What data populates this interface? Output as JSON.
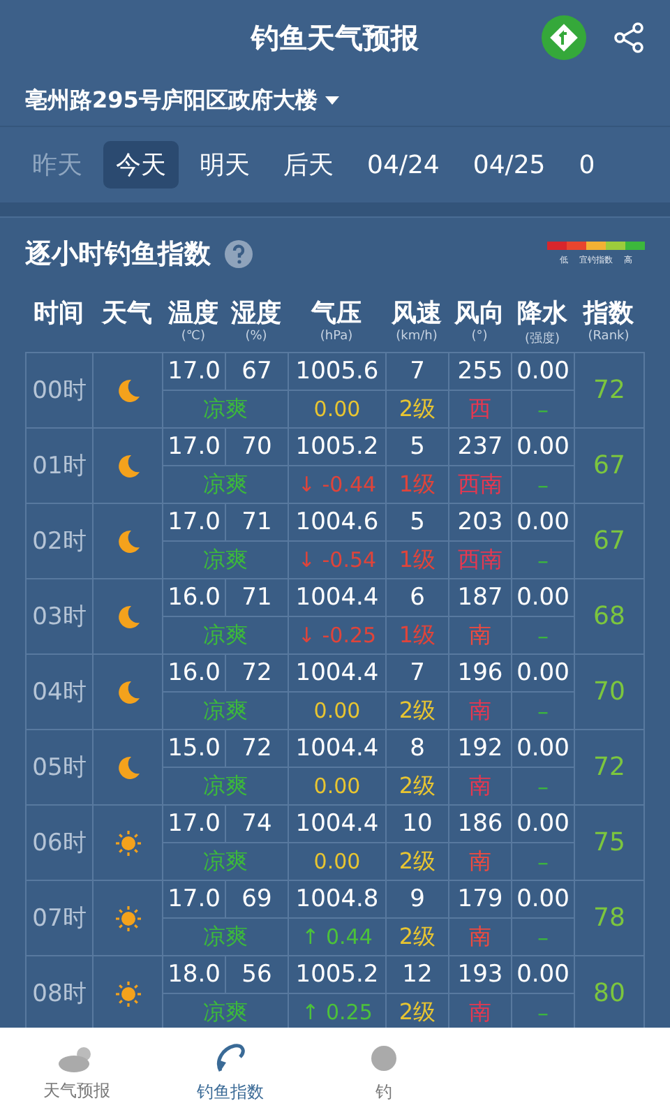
{
  "header": {
    "title": "钓鱼天气预报"
  },
  "location": {
    "text": "亳州路295号庐阳区政府大楼"
  },
  "date_tabs": [
    {
      "label": "昨天",
      "selected": false,
      "disabled": true
    },
    {
      "label": "今天",
      "selected": true,
      "disabled": false
    },
    {
      "label": "明天",
      "selected": false,
      "disabled": false
    },
    {
      "label": "后天",
      "selected": false,
      "disabled": false
    },
    {
      "label": "04/24",
      "selected": false,
      "disabled": false
    },
    {
      "label": "04/25",
      "selected": false,
      "disabled": false
    },
    {
      "label": "0",
      "selected": false,
      "disabled": false
    }
  ],
  "section": {
    "title": "逐小时钓鱼指数",
    "legend": {
      "low": "低",
      "label": "宜钓指数",
      "high": "高",
      "segments": [
        {
          "color": "#d8262c"
        },
        {
          "color": "#e8452e"
        },
        {
          "color": "#f2b134"
        },
        {
          "color": "#9ccc3c"
        },
        {
          "color": "#3cb83c"
        }
      ]
    }
  },
  "table": {
    "columns": [
      {
        "label": "时间"
      },
      {
        "label": "天气"
      },
      {
        "label": "温度",
        "unit": "(℃)"
      },
      {
        "label": "湿度",
        "unit": "(%)"
      },
      {
        "label": "气压",
        "unit": "(hPa)"
      },
      {
        "label": "风速",
        "unit": "(km/h)"
      },
      {
        "label": "风向",
        "unit": "(°)"
      },
      {
        "label": "降水",
        "unit": "(强度)"
      },
      {
        "label": "指数",
        "unit": "(Rank)"
      }
    ],
    "rows": [
      {
        "time": "00时",
        "weather": {
          "kind": "moon"
        },
        "temp": "17.0",
        "humidity": "67",
        "pressure": "1005.6",
        "wind": "7",
        "direction": "255",
        "precip": "0.00",
        "comfort": "凉爽",
        "pressure_change": {
          "text": "0.00",
          "color": "#e8c531"
        },
        "wind_level": {
          "text": "2级",
          "color": "#e8c531"
        },
        "direction_name": {
          "text": "西",
          "color": "#e8374f"
        },
        "precip_level": "–",
        "index": "72"
      },
      {
        "time": "01时",
        "weather": {
          "kind": "moon"
        },
        "temp": "17.0",
        "humidity": "70",
        "pressure": "1005.2",
        "wind": "5",
        "direction": "237",
        "precip": "0.00",
        "comfort": "凉爽",
        "pressure_change": {
          "text": "↓ -0.44",
          "color": "#e0443a"
        },
        "wind_level": {
          "text": "1级",
          "color": "#e0443a"
        },
        "direction_name": {
          "text": "西南",
          "color": "#e8374f"
        },
        "precip_level": "–",
        "index": "67"
      },
      {
        "time": "02时",
        "weather": {
          "kind": "moon"
        },
        "temp": "17.0",
        "humidity": "71",
        "pressure": "1004.6",
        "wind": "5",
        "direction": "203",
        "precip": "0.00",
        "comfort": "凉爽",
        "pressure_change": {
          "text": "↓ -0.54",
          "color": "#e0443a"
        },
        "wind_level": {
          "text": "1级",
          "color": "#e0443a"
        },
        "direction_name": {
          "text": "西南",
          "color": "#e8374f"
        },
        "precip_level": "–",
        "index": "67"
      },
      {
        "time": "03时",
        "weather": {
          "kind": "moon"
        },
        "temp": "16.0",
        "humidity": "71",
        "pressure": "1004.4",
        "wind": "6",
        "direction": "187",
        "precip": "0.00",
        "comfort": "凉爽",
        "pressure_change": {
          "text": "↓ -0.25",
          "color": "#e0443a"
        },
        "wind_level": {
          "text": "1级",
          "color": "#e0443a"
        },
        "direction_name": {
          "text": "南",
          "color": "#f04a3e"
        },
        "precip_level": "–",
        "index": "68"
      },
      {
        "time": "04时",
        "weather": {
          "kind": "moon"
        },
        "temp": "16.0",
        "humidity": "72",
        "pressure": "1004.4",
        "wind": "7",
        "direction": "196",
        "precip": "0.00",
        "comfort": "凉爽",
        "pressure_change": {
          "text": "0.00",
          "color": "#e8c531"
        },
        "wind_level": {
          "text": "2级",
          "color": "#e8c531"
        },
        "direction_name": {
          "text": "南",
          "color": "#e8374f"
        },
        "precip_level": "–",
        "index": "70"
      },
      {
        "time": "05时",
        "weather": {
          "kind": "moon"
        },
        "temp": "15.0",
        "humidity": "72",
        "pressure": "1004.4",
        "wind": "8",
        "direction": "192",
        "precip": "0.00",
        "comfort": "凉爽",
        "pressure_change": {
          "text": "0.00",
          "color": "#e8c531"
        },
        "wind_level": {
          "text": "2级",
          "color": "#e8c531"
        },
        "direction_name": {
          "text": "南",
          "color": "#e8374f"
        },
        "precip_level": "–",
        "index": "72"
      },
      {
        "time": "06时",
        "weather": {
          "kind": "sun"
        },
        "temp": "17.0",
        "humidity": "74",
        "pressure": "1004.4",
        "wind": "10",
        "direction": "186",
        "precip": "0.00",
        "comfort": "凉爽",
        "pressure_change": {
          "text": "0.00",
          "color": "#e8c531"
        },
        "wind_level": {
          "text": "2级",
          "color": "#e8c531"
        },
        "direction_name": {
          "text": "南",
          "color": "#f04a3e"
        },
        "precip_level": "–",
        "index": "75"
      },
      {
        "time": "07时",
        "weather": {
          "kind": "sun"
        },
        "temp": "17.0",
        "humidity": "69",
        "pressure": "1004.8",
        "wind": "9",
        "direction": "179",
        "precip": "0.00",
        "comfort": "凉爽",
        "pressure_change": {
          "text": "↑ 0.44",
          "color": "#4cc23a"
        },
        "wind_level": {
          "text": "2级",
          "color": "#e8c531"
        },
        "direction_name": {
          "text": "南",
          "color": "#f04a3e"
        },
        "precip_level": "–",
        "index": "78"
      },
      {
        "time": "08时",
        "weather": {
          "kind": "sun"
        },
        "temp": "18.0",
        "humidity": "56",
        "pressure": "1005.2",
        "wind": "12",
        "direction": "193",
        "precip": "0.00",
        "comfort": "凉爽",
        "pressure_change": {
          "text": "↑ 0.25",
          "color": "#4cc23a"
        },
        "wind_level": {
          "text": "2级",
          "color": "#e8c531"
        },
        "direction_name": {
          "text": "南",
          "color": "#e8374f"
        },
        "precip_level": "–",
        "index": "80"
      }
    ]
  },
  "bottom_tabs": [
    {
      "label": "天气预报",
      "kind": "weather",
      "selected": false
    },
    {
      "label": "钓鱼指数",
      "kind": "fishing",
      "selected": true
    },
    {
      "label": "钓",
      "kind": "other",
      "selected": false
    }
  ]
}
